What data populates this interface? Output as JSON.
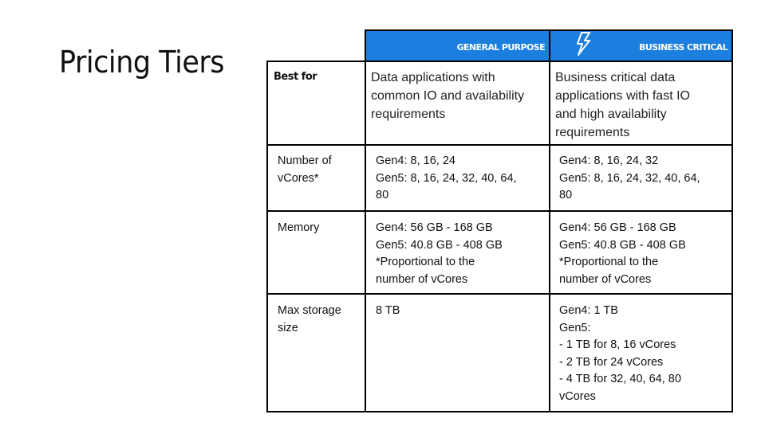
{
  "page_title": "Pricing Tiers",
  "colors": {
    "header_bg": "#1b7fe0",
    "header_text": "#ffffff",
    "border": "#000000"
  },
  "table": {
    "columns": [
      {
        "label": "GENERAL PURPOSE",
        "icon": ""
      },
      {
        "label": "BUSINESS CRITICAL",
        "icon": "lightning-bolt-icon"
      }
    ],
    "rows": [
      {
        "label": "Best for",
        "general_purpose": [
          "Data applications with",
          "common IO and availability",
          "requirements"
        ],
        "business_critical": [
          "Business critical data",
          "applications with fast IO",
          "and high availability",
          "requirements"
        ]
      },
      {
        "label_lines": [
          "Number of",
          "vCores*"
        ],
        "general_purpose": [
          "Gen4: 8, 16, 24",
          "Gen5: 8, 16, 24, 32, 40, 64,",
          "80"
        ],
        "business_critical": [
          "Gen4: 8, 16, 24, 32",
          "Gen5: 8, 16, 24, 32, 40, 64,",
          "80"
        ]
      },
      {
        "label_lines": [
          "Memory"
        ],
        "general_purpose": [
          "Gen4: 56 GB - 168 GB",
          "Gen5: 40.8 GB - 408 GB",
          "*Proportional to the",
          "number of vCores"
        ],
        "business_critical": [
          "Gen4: 56 GB - 168 GB",
          "Gen5: 40.8 GB - 408 GB",
          "*Proportional to the",
          "number of vCores"
        ]
      },
      {
        "label_lines": [
          "Max storage",
          "size"
        ],
        "general_purpose": [
          "8 TB"
        ],
        "business_critical": [
          "Gen4: 1 TB",
          "Gen5:",
          "- 1 TB for 8, 16 vCores",
          "- 2 TB for 24 vCores",
          "- 4 TB for 32, 40, 64, 80",
          "vCores"
        ]
      }
    ]
  }
}
